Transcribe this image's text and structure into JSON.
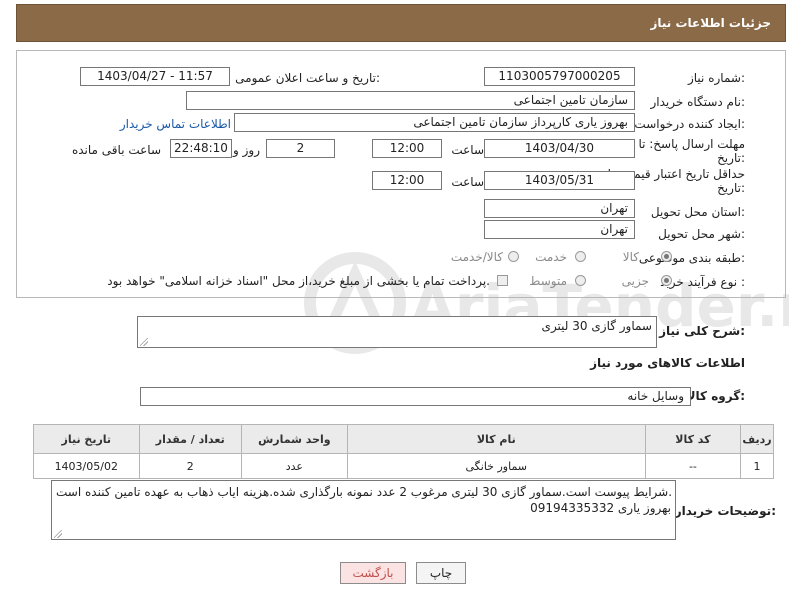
{
  "header": {
    "title": "جزئیات اطلاعات نیاز"
  },
  "form": {
    "need_number_label": "شماره نیاز:",
    "need_number": "1103005797000205",
    "announce_label": "تاریخ و ساعت اعلان عمومی:",
    "announce_value": "1403/04/27 - 11:57",
    "buyer_org_label": "نام دستگاه خریدار:",
    "buyer_org": "سازمان تامین اجتماعی",
    "creator_label": "ایجاد کننده درخواست:",
    "creator": "بهروز یاری کارپرداز سازمان تامین اجتماعی",
    "contact_link": "اطلاعات تماس خریدار",
    "reply_deadline_label_1": "مهلت ارسال پاسخ: تا",
    "reply_deadline_label_2": "تاریخ:",
    "reply_date": "1403/04/30",
    "time_label": "ساعت",
    "reply_time": "12:00",
    "days_value": "2",
    "days_label": "روز و",
    "remaining_time": "22:48:10",
    "remaining_label": "ساعت باقی مانده",
    "validity_label_1": "حداقل تاریخ اعتبار قیمت: تا",
    "validity_label_2": "تاریخ:",
    "validity_date": "1403/05/31",
    "validity_time": "12:00",
    "province_label": "استان محل تحویل:",
    "province": "تهران",
    "city_label": "شهر محل تحویل:",
    "city": "تهران",
    "category_label": "طبقه بندی موضوعی:",
    "category_options": [
      "کالا",
      "خدمت",
      "کالا/خدمت"
    ],
    "purchase_type_label": "نوع فرآیند خرید :",
    "purchase_options": [
      "جزیی",
      "متوسط"
    ],
    "treasury_note": "پرداخت تمام یا بخشی از مبلغ خرید،از محل \"اسناد خزانه اسلامی\" خواهد بود."
  },
  "description": {
    "label": "شرح کلی نیاز:",
    "value": "سماور گازی 30 لیتری"
  },
  "goods_info_title": "اطلاعات کالاهای مورد نیاز",
  "goods_group": {
    "label": "گروه کالا:",
    "value": "وسایل خانه"
  },
  "table": {
    "headers": [
      "ردیف",
      "کد کالا",
      "نام کالا",
      "واحد شمارش",
      "تعداد / مقدار",
      "تاریخ نیاز"
    ],
    "rows": [
      [
        "1",
        "--",
        "سماور خانگی",
        "عدد",
        "2",
        "1403/05/02"
      ]
    ]
  },
  "buyer_notes": {
    "label": "توضیحات خریدار:",
    "line1": "شرایط پیوست است.سماور گازی 30 لیتری مرغوب 2 عدد نمونه بارگذاری شده.هزینه ایاب ذهاب به عهده تامین کننده است.",
    "line2": "09194335332 بهروز یاری"
  },
  "buttons": {
    "print": "چاپ",
    "back": "بازگشت"
  },
  "watermark": {
    "text": "AriaTender.neT"
  },
  "colors": {
    "header_bg": "#8b6a48",
    "link": "#1a5aa8",
    "back_button_bg": "#fbe3e3",
    "back_button_text": "#c0504d"
  }
}
